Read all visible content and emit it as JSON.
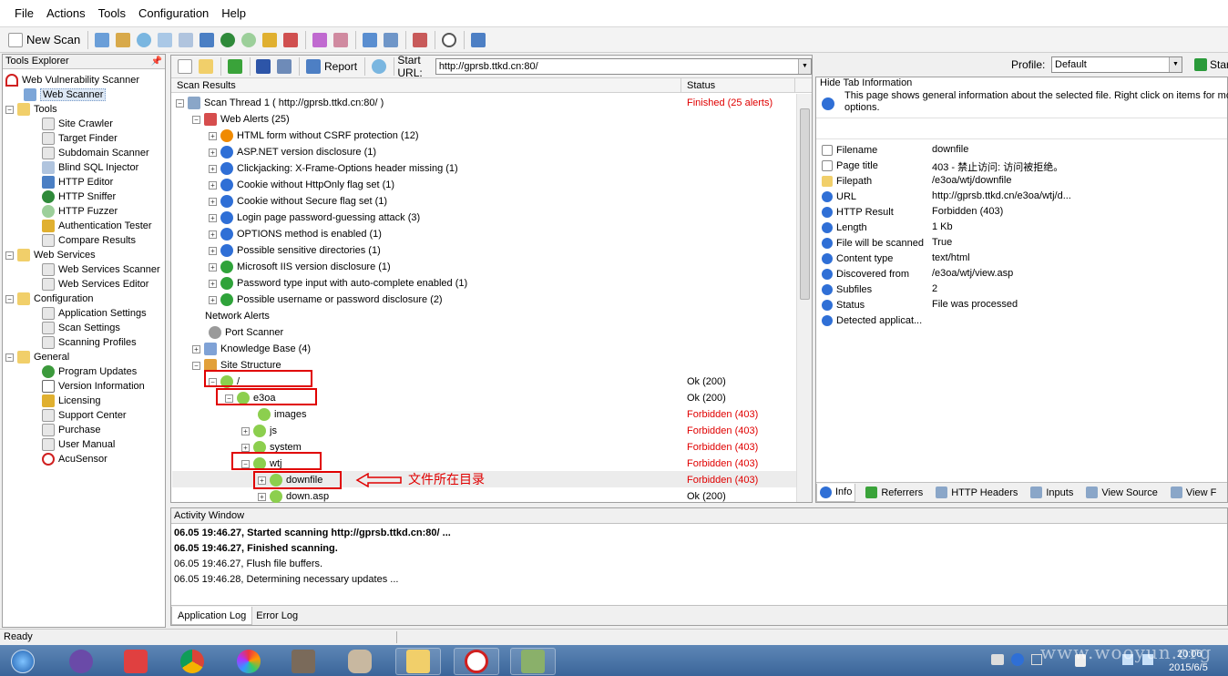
{
  "menu": [
    "File",
    "Actions",
    "Tools",
    "Configuration",
    "Help"
  ],
  "toolbar": {
    "new_scan": "New Scan"
  },
  "center_toolbar": {
    "report": "Report",
    "start_url_label": "Start URL:",
    "start_url": "http://gprsb.ttkd.cn:80/",
    "profile_label": "Profile:",
    "profile": "Default",
    "start": "Star"
  },
  "tools_explorer": {
    "title": "Tools Explorer",
    "items": [
      "Web Vulnerability Scanner",
      "Web Scanner",
      "Tools",
      "Site Crawler",
      "Target Finder",
      "Subdomain Scanner",
      "Blind SQL Injector",
      "HTTP Editor",
      "HTTP Sniffer",
      "HTTP Fuzzer",
      "Authentication Tester",
      "Compare Results",
      "Web Services",
      "Web Services Scanner",
      "Web Services Editor",
      "Configuration",
      "Application Settings",
      "Scan Settings",
      "Scanning Profiles",
      "General",
      "Program Updates",
      "Version Information",
      "Licensing",
      "Support Center",
      "Purchase",
      "User Manual",
      "AcuSensor"
    ]
  },
  "scan_results": {
    "col_name": "Scan Results",
    "col_status": "Status",
    "rows": [
      {
        "label": "Scan Thread 1 ( http://gprsb.ttkd.cn:80/ )",
        "status": "Finished (25 alerts)"
      },
      {
        "label": "Web Alerts (25)",
        "status": ""
      },
      {
        "label": "HTML form without CSRF protection (12)",
        "status": ""
      },
      {
        "label": "ASP.NET version disclosure (1)",
        "status": ""
      },
      {
        "label": "Clickjacking: X-Frame-Options header missing (1)",
        "status": ""
      },
      {
        "label": "Cookie without HttpOnly flag set (1)",
        "status": ""
      },
      {
        "label": "Cookie without Secure flag set (1)",
        "status": ""
      },
      {
        "label": "Login page password-guessing attack (3)",
        "status": ""
      },
      {
        "label": "OPTIONS method is enabled (1)",
        "status": ""
      },
      {
        "label": "Possible sensitive directories (1)",
        "status": ""
      },
      {
        "label": "Microsoft IIS version disclosure (1)",
        "status": ""
      },
      {
        "label": "Password type input with auto-complete enabled (1)",
        "status": ""
      },
      {
        "label": "Possible username or password disclosure (2)",
        "status": ""
      },
      {
        "label": "Network Alerts",
        "status": ""
      },
      {
        "label": "Port Scanner",
        "status": ""
      },
      {
        "label": "Knowledge Base (4)",
        "status": ""
      },
      {
        "label": "Site Structure",
        "status": ""
      },
      {
        "label": "/",
        "status": "Ok (200)"
      },
      {
        "label": "e3oa",
        "status": "Ok (200)"
      },
      {
        "label": "images",
        "status": "Forbidden (403)"
      },
      {
        "label": "js",
        "status": "Forbidden (403)"
      },
      {
        "label": "system",
        "status": "Forbidden (403)"
      },
      {
        "label": "wtj",
        "status": "Forbidden (403)"
      },
      {
        "label": "downfile",
        "status": "Forbidden (403)"
      },
      {
        "label": "down.asp",
        "status": "Ok (200)"
      }
    ],
    "annotation": "文件所在目录"
  },
  "tab_info": {
    "title": "Hide Tab Information",
    "desc_line1": "This page shows general information about the selected file. Right click on items for more",
    "desc_line2": "options.",
    "props": [
      {
        "name": "Filename",
        "value": "downfile"
      },
      {
        "name": "Page title",
        "value": "403 - 禁止访问: 访问被拒绝。"
      },
      {
        "name": "Filepath",
        "value": "/e3oa/wtj/downfile"
      },
      {
        "name": "URL",
        "value": "http://gprsb.ttkd.cn/e3oa/wtj/d..."
      },
      {
        "name": "HTTP Result",
        "value": "Forbidden (403)"
      },
      {
        "name": "Length",
        "value": "1 Kb"
      },
      {
        "name": "File will be scanned",
        "value": "True"
      },
      {
        "name": "Content type",
        "value": "text/html"
      },
      {
        "name": "Discovered from",
        "value": "/e3oa/wtj/view.asp"
      },
      {
        "name": "Subfiles",
        "value": "2"
      },
      {
        "name": "Status",
        "value": "File was processed"
      },
      {
        "name": "Detected applicat...",
        "value": ""
      }
    ],
    "tabs": [
      "Info",
      "Referrers",
      "HTTP Headers",
      "Inputs",
      "View Source",
      "View F"
    ]
  },
  "activity": {
    "title": "Activity Window",
    "lines": [
      "06.05 19:46.27, Started scanning http://gprsb.ttkd.cn:80/ ...",
      "06.05 19:46.27, Finished scanning.",
      "06.05 19:46.27, Flush file buffers.",
      "06.05 19:46.28, Determining necessary updates ..."
    ],
    "tabs": [
      "Application Log",
      "Error Log"
    ]
  },
  "status_text": "Ready",
  "taskbar": {
    "clock_time": "20:06",
    "clock_date": "2015/6/5",
    "watermark": "www.wooyun.org"
  }
}
